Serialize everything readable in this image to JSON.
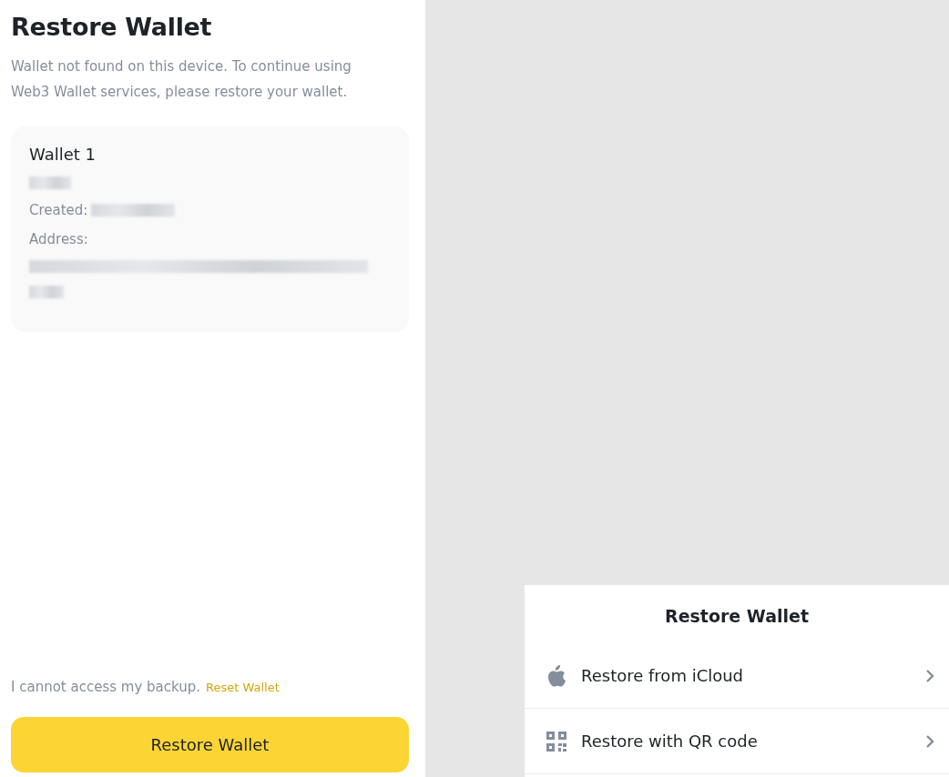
{
  "page": {
    "title": "Restore Wallet",
    "description": "Wallet not found on this device. To continue using Web3 Wallet services, please restore your wallet."
  },
  "wallet_card": {
    "name": "Wallet 1",
    "created_label": "Created:",
    "address_label": "Address:"
  },
  "footer": {
    "note": "I cannot access my backup.",
    "link": "Reset Wallet",
    "button": "Restore Wallet"
  },
  "sheet": {
    "title": "Restore Wallet",
    "options": [
      {
        "kind": "icloud",
        "label": "Restore from iCloud"
      },
      {
        "kind": "qr",
        "label": "Restore with QR code"
      }
    ]
  }
}
